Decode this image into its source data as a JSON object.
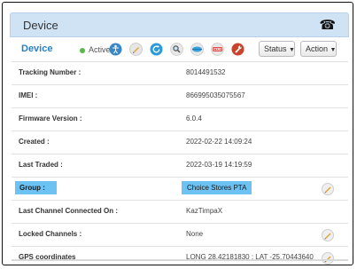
{
  "panel": {
    "title": "Device"
  },
  "toolbar": {
    "title": "Device",
    "status_label": "Active",
    "status_color": "#58b947",
    "icons": [
      "accessibility-icon",
      "pencil-icon",
      "refresh-icon",
      "search-icon",
      "mouse-icon",
      "cod-badge-icon",
      "wrench-icon"
    ],
    "status_dropdown": "Status",
    "action_dropdown": "Action"
  },
  "rows": [
    {
      "label": "Tracking Number :",
      "value": "8014491532"
    },
    {
      "label": "IMEI :",
      "value": "866995035075567"
    },
    {
      "label": "Firmware Version :",
      "value": "6.0.4"
    },
    {
      "label": "Created :",
      "value": "2022-02-22 14:09:24"
    },
    {
      "label": "Last Traded :",
      "value": "2022-03-19 14:19:59"
    },
    {
      "label": "Group :",
      "value": "Choice Stores PTA",
      "highlighted": true,
      "editable": true
    },
    {
      "label": "Last Channel Connected On :",
      "value": "KazTimpaX"
    },
    {
      "label": "Locked Channels :",
      "value": "None",
      "editable": true
    },
    {
      "label": "GPS coordinates",
      "value": "LONG 28.42181830 : LAT -25.70443640",
      "editable": true
    }
  ],
  "colors": {
    "accent": "#2a7fc4",
    "header_bg": "#cfe3f5",
    "highlight": "#6cc2f2"
  }
}
